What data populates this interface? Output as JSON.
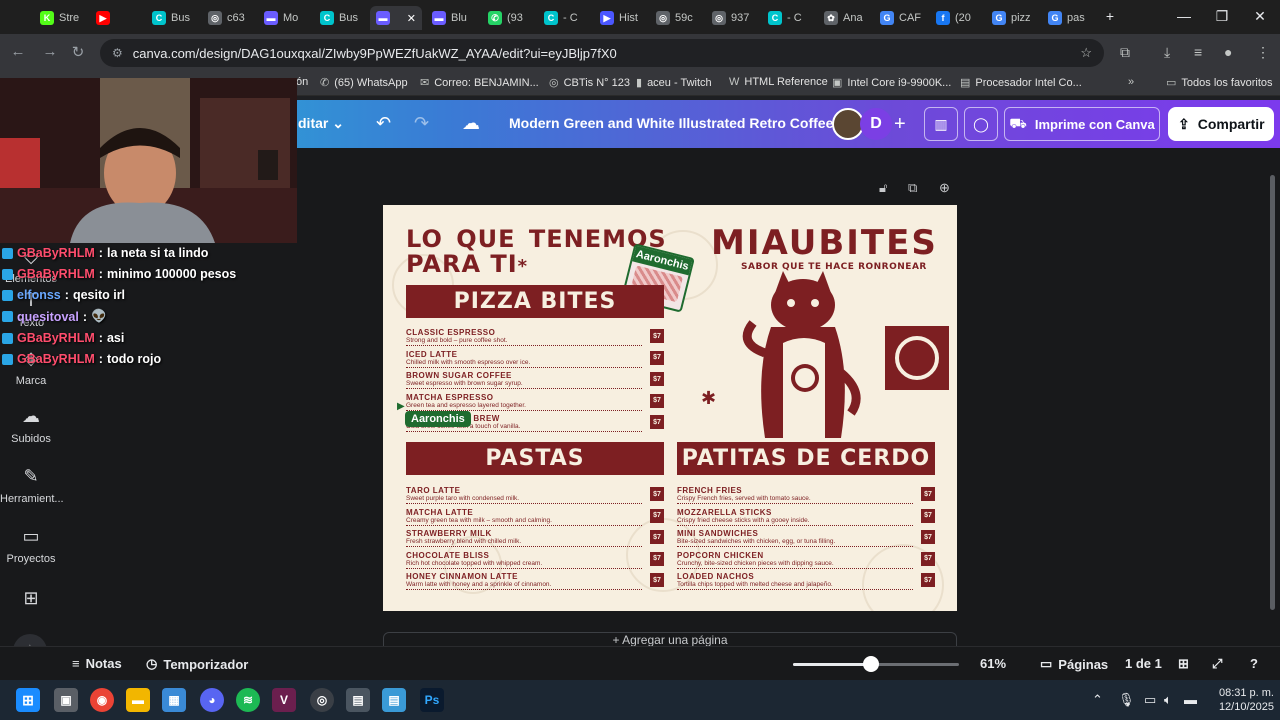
{
  "browser": {
    "tabs": [
      {
        "label": "Stre",
        "icon": "kick-icon",
        "color": "#53fc18",
        "glyph": "K"
      },
      {
        "label": "",
        "icon": "youtube-icon",
        "color": "#ff0000",
        "glyph": "▶"
      },
      {
        "label": "Bus",
        "icon": "canva-icon",
        "color": "#00c4cc",
        "glyph": "C"
      },
      {
        "label": "c63",
        "icon": "globe-icon",
        "color": "#5f6368",
        "glyph": "◎"
      },
      {
        "label": "Mo",
        "icon": "canva-doc-icon",
        "color": "#6a5cff",
        "glyph": "▬"
      },
      {
        "label": "Bus",
        "icon": "canva-icon",
        "color": "#00c4cc",
        "glyph": "C"
      },
      {
        "label": "",
        "icon": "canva-doc-icon",
        "color": "#6a5cff",
        "glyph": "▬",
        "active": true
      },
      {
        "label": "Blu",
        "icon": "canva-doc-icon",
        "color": "#6a5cff",
        "glyph": "▬"
      },
      {
        "label": "(93",
        "icon": "whatsapp-icon",
        "color": "#25d366",
        "glyph": "✆"
      },
      {
        "label": "- C",
        "icon": "canva-icon",
        "color": "#00c4cc",
        "glyph": "C"
      },
      {
        "label": "Hist",
        "icon": "video-icon",
        "color": "#4b57ff",
        "glyph": "▶"
      },
      {
        "label": "59c",
        "icon": "globe-icon",
        "color": "#5f6368",
        "glyph": "◎"
      },
      {
        "label": "937",
        "icon": "globe-icon",
        "color": "#5f6368",
        "glyph": "◎"
      },
      {
        "label": "- C",
        "icon": "canva-icon",
        "color": "#00c4cc",
        "glyph": "C"
      },
      {
        "label": "Ana",
        "icon": "openai-icon",
        "color": "#5f6368",
        "glyph": "✿"
      },
      {
        "label": "CAF",
        "icon": "google-icon",
        "color": "#4285f4",
        "glyph": "G"
      },
      {
        "label": "(20",
        "icon": "facebook-icon",
        "color": "#1877f2",
        "glyph": "f"
      },
      {
        "label": "pizz",
        "icon": "google-icon",
        "color": "#4285f4",
        "glyph": "G"
      },
      {
        "label": "pas",
        "icon": "google-icon",
        "color": "#4285f4",
        "glyph": "G"
      }
    ],
    "url": "canva.com/design/DAG1ouxqxal/ZIwby9PpWEZfUakWZ_AYAA/edit?ui=eyJBljp7fX0",
    "bookmarks": [
      {
        "label": "ón",
        "icon": "none"
      },
      {
        "label": "(65) WhatsApp",
        "icon": "whatsapp-icon"
      },
      {
        "label": "Correo: BENJAMIN...",
        "icon": "outlook-icon"
      },
      {
        "label": "CBTis N° 123",
        "icon": "globe-icon"
      },
      {
        "label": "aceu - Twitch",
        "icon": "twitch-icon"
      },
      {
        "label": "HTML Reference",
        "icon": "w3-icon"
      },
      {
        "label": "Intel Core i9-9900K...",
        "icon": "intel-icon"
      },
      {
        "label": "Procesador Intel Co...",
        "icon": "doc-icon"
      }
    ],
    "all_bookmarks": "Todos los favoritos"
  },
  "canva": {
    "edit_label": "ditar",
    "doc_title": "Modern Green and White Illustrated Retro Coffee M...",
    "avatar_letter": "D",
    "print_label": "Imprime con Canva",
    "share_label": "Compartir",
    "sidebar": [
      {
        "label": "Elementos",
        "icon": "elements-icon"
      },
      {
        "label": "Texto",
        "icon": "text-icon"
      },
      {
        "label": "Marca",
        "icon": "brand-icon"
      },
      {
        "label": "Subidos",
        "icon": "upload-icon"
      },
      {
        "label": "Herramient...",
        "icon": "tools-icon"
      },
      {
        "label": "Proyectos",
        "icon": "folder-icon"
      },
      {
        "label": "",
        "icon": "apps-icon"
      }
    ],
    "add_page": "+ Agregar una página",
    "footer": {
      "notes": "Notas",
      "timer": "Temporizador",
      "zoom": "61%",
      "zoom_level": 0.47,
      "pages": "Páginas",
      "page_count": "1 de 1"
    }
  },
  "chat": [
    {
      "user": "GBaByRHLM",
      "msg": "la neta si ta lindo",
      "color": "#ff4d6d"
    },
    {
      "user": "GBaByRHLM",
      "msg": "minimo 100000 pesos",
      "color": "#ff4d6d"
    },
    {
      "user": "elfonss",
      "msg": "qesito irl",
      "color": "#6aa8ff"
    },
    {
      "user": "quesitoval",
      "msg": "👽",
      "color": "#c8a2ff"
    },
    {
      "user": "GBaByRHLM",
      "msg": "asi",
      "color": "#ff4d6d"
    },
    {
      "user": "GBaByRHLM",
      "msg": "todo rojo",
      "color": "#ff4d6d"
    }
  ],
  "menu": {
    "headline": "LO  QUE  TENEMOS",
    "headline2": "PARA TI",
    "brand": "MIAUBITES",
    "tagline": "SABOR QUE TE HACE RONRONEAR",
    "sticker": "Aaronchis",
    "cursor_tag": "Aaronchis",
    "sections": {
      "pizza": "PIZZA BITES",
      "pastas": "PASTAS",
      "patitas": "PATITAS DE CERDO"
    },
    "pizza_items": [
      {
        "name": "CLASSIC ESPRESSO",
        "desc": "Strong and bold – pure coffee shot.",
        "price": "$7"
      },
      {
        "name": "ICED LATTE",
        "desc": "Chilled milk with smooth espresso over ice.",
        "price": "$7"
      },
      {
        "name": "BROWN SUGAR COFFEE",
        "desc": "Sweet espresso with brown sugar syrup.",
        "price": "$7"
      },
      {
        "name": "MATCHA ESPRESSO",
        "desc": "Green tea and espresso layered together.",
        "price": "$7"
      },
      {
        "name": "VANILLA COLD BREW",
        "desc": "Cold brew coffee with a touch of vanilla.",
        "price": "$7"
      }
    ],
    "pasta_items": [
      {
        "name": "TARO LATTE",
        "desc": "Sweet purple taro with condensed milk.",
        "price": "$7"
      },
      {
        "name": "MATCHA LATTE",
        "desc": "Creamy green tea with milk – smooth and calming.",
        "price": "$7"
      },
      {
        "name": "STRAWBERRY MILK",
        "desc": "Fresh strawberry blend with chilled milk.",
        "price": "$7"
      },
      {
        "name": "CHOCOLATE BLISS",
        "desc": "Rich hot chocolate topped with whipped cream.",
        "price": "$7"
      },
      {
        "name": "HONEY CINNAMON LATTE",
        "desc": "Warm latte with honey and a sprinkle of cinnamon.",
        "price": "$7"
      }
    ],
    "patitas_items": [
      {
        "name": "FRENCH FRIES",
        "desc": "Crispy French fries, served with tomato sauce.",
        "price": "$7"
      },
      {
        "name": "MOZZARELLA STICKS",
        "desc": "Crispy fried cheese sticks with a gooey inside.",
        "price": "$7"
      },
      {
        "name": "MINI SANDWICHES",
        "desc": "Bite-sized sandwiches with chicken, egg, or tuna filling.",
        "price": "$7"
      },
      {
        "name": "POPCORN CHICKEN",
        "desc": "Crunchy, bite-sized chicken pieces with dipping sauce.",
        "price": "$7"
      },
      {
        "name": "LOADED NACHOS",
        "desc": "Tortilla chips topped with melted cheese and jalapeño.",
        "price": "$7"
      }
    ]
  },
  "taskbar": {
    "time": "08:31 p. m.",
    "date": "12/10/2025"
  },
  "colors": {
    "menu_red": "#7d1f22",
    "menu_cream": "#f7efe0",
    "tag_green": "#1f6b2f"
  }
}
